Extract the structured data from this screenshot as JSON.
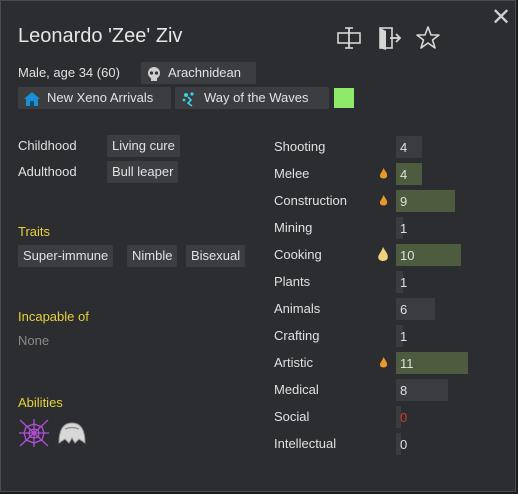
{
  "colonist": {
    "name": "Leonardo 'Zee' Ziv",
    "description": "Male, age 34 (60)",
    "xenotype": "Arachnidean"
  },
  "header_icons": [
    "rename-icon",
    "banish-icon",
    "favorite-star-icon"
  ],
  "affiliations": [
    {
      "label": "New Xeno Arrivals",
      "icon": "faction-house-icon",
      "color": "#1e8fd6"
    },
    {
      "label": "Way of the Waves",
      "icon": "ideology-icon",
      "color": "#3ad0e6"
    }
  ],
  "favorite_color": "#8fea6a",
  "backstory": {
    "childhood_label": "Childhood",
    "childhood_value": "Living cure",
    "adulthood_label": "Adulthood",
    "adulthood_value": "Bull leaper"
  },
  "traits": {
    "title": "Traits",
    "items": [
      "Super-immune",
      "Nimble",
      "Bisexual"
    ]
  },
  "incapable": {
    "title": "Incapable of",
    "value": "None"
  },
  "abilities": {
    "title": "Abilities",
    "icons": [
      "web-ability-icon",
      "shell-ability-icon"
    ]
  },
  "skills": [
    {
      "name": "Shooting",
      "value": "4",
      "level": 4,
      "passion": "none"
    },
    {
      "name": "Melee",
      "value": "4",
      "level": 4,
      "passion": "minor"
    },
    {
      "name": "Construction",
      "value": "9",
      "level": 9,
      "passion": "minor"
    },
    {
      "name": "Mining",
      "value": "1",
      "level": 1,
      "passion": "none"
    },
    {
      "name": "Cooking",
      "value": "10",
      "level": 10,
      "passion": "major"
    },
    {
      "name": "Plants",
      "value": "1",
      "level": 1,
      "passion": "none"
    },
    {
      "name": "Animals",
      "value": "6",
      "level": 6,
      "passion": "none"
    },
    {
      "name": "Crafting",
      "value": "1",
      "level": 1,
      "passion": "none"
    },
    {
      "name": "Artistic",
      "value": "11",
      "level": 11,
      "passion": "minor"
    },
    {
      "name": "Medical",
      "value": "8",
      "level": 8,
      "passion": "none"
    },
    {
      "name": "Social",
      "value": "0",
      "level": 0,
      "passion": "none",
      "disabled": true
    },
    {
      "name": "Intellectual",
      "value": "0",
      "level": 0,
      "passion": "none"
    }
  ],
  "skill_max_level": 20
}
